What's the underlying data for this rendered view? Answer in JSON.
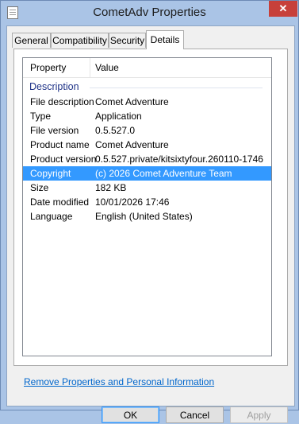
{
  "window": {
    "title": "CometAdv Properties",
    "close_glyph": "✕"
  },
  "tabs": [
    {
      "label": "General"
    },
    {
      "label": "Compatibility"
    },
    {
      "label": "Security"
    },
    {
      "label": "Details",
      "active": true
    }
  ],
  "details": {
    "columns": [
      "Property",
      "Value"
    ],
    "group_label": "Description",
    "rows": [
      {
        "property": "File description",
        "value": "Comet Adventure"
      },
      {
        "property": "Type",
        "value": "Application"
      },
      {
        "property": "File version",
        "value": "0.5.527.0"
      },
      {
        "property": "Product name",
        "value": "Comet Adventure"
      },
      {
        "property": "Product version",
        "value": "0.5.527.private/kitsixtyfour.260110-1746"
      },
      {
        "property": "Copyright",
        "value": "(c) 2026 Comet Adventure Team",
        "selected": true
      },
      {
        "property": "Size",
        "value": "182 KB"
      },
      {
        "property": "Date modified",
        "value": "10/01/2026 17:46"
      },
      {
        "property": "Language",
        "value": "English (United States)"
      }
    ]
  },
  "remove_link": "Remove Properties and Personal Information",
  "buttons": {
    "ok": "OK",
    "cancel": "Cancel",
    "apply": "Apply"
  },
  "colors": {
    "frame": "#aac4e6",
    "close": "#c7403a",
    "selection": "#3399ff",
    "group_header": "#1e3287",
    "link": "#0066cc"
  }
}
